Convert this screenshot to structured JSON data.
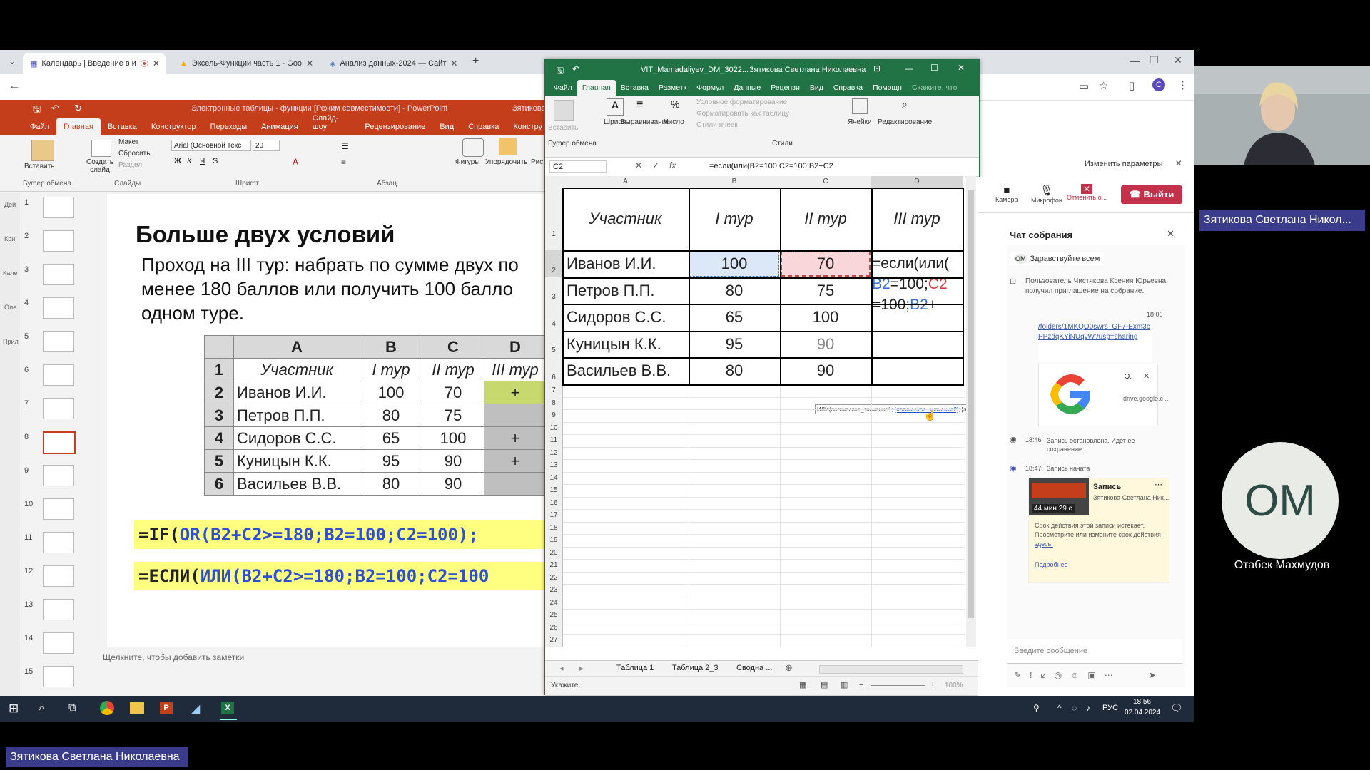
{
  "browser": {
    "tabs": [
      {
        "label": "Календарь | Введение в и",
        "active": true
      },
      {
        "label": "Эксель-Функции часть 1 - Goo",
        "active": false
      },
      {
        "label": "Анализ данных-2024 — Сайт",
        "active": false
      }
    ]
  },
  "ppt": {
    "title": "Электронные таблицы - функции [Режим совместимости] - PowerPoint",
    "user": "Зятикова",
    "tabs": [
      "Файл",
      "Главная",
      "Вставка",
      "Конструктор",
      "Переходы",
      "Анимация",
      "Слайд-шоу",
      "Рецензирование",
      "Вид",
      "Справка",
      "Констру"
    ],
    "ribbon": {
      "paste": "Вставить",
      "new_slide": "Создать слайд",
      "layout": "Макет",
      "reset": "Сбросить",
      "section": "Раздел",
      "font_name": "Arial (Основной текс",
      "font_size": "20",
      "shapes": "Фигуры",
      "arrange": "Упорядочить",
      "drawing_short": "Рис",
      "groups": [
        "Буфер обмена",
        "Слайды",
        "Шрифт",
        "Абзац"
      ]
    },
    "thumb_numbers": [
      "1",
      "2",
      "3",
      "4",
      "5",
      "6",
      "7",
      "8",
      "9",
      "10",
      "11",
      "12",
      "13",
      "14",
      "15"
    ],
    "left_rail": [
      "Дей",
      "Кри",
      "Кале",
      "Оле",
      "Прил"
    ],
    "notes_placeholder": "Щелкните, чтобы добавить заметки",
    "slide": {
      "title": "Больше двух условий",
      "body": "Проход на III тур: набрать по сумме двух по менее 180 баллов или получить 100 балло одном туре.",
      "table": {
        "cols": [
          "A",
          "B",
          "C",
          "D"
        ],
        "header": [
          "Участник",
          "I тур",
          "II тур",
          "III тур"
        ],
        "rows": [
          {
            "n": "2",
            "name": "Иванов И.И.",
            "b": "100",
            "c": "70",
            "d": "+"
          },
          {
            "n": "3",
            "name": "Петров П.П.",
            "b": "80",
            "c": "75",
            "d": ""
          },
          {
            "n": "4",
            "name": "Сидоров С.С.",
            "b": "65",
            "c": "100",
            "d": "+"
          },
          {
            "n": "5",
            "name": "Куницын К.К.",
            "b": "95",
            "c": "90",
            "d": "+"
          },
          {
            "n": "6",
            "name": "Васильев В.В.",
            "b": "80",
            "c": "90",
            "d": ""
          }
        ],
        "header_row_num": "1"
      },
      "formula_en_prefix": "=IF(",
      "formula_en_func": "OR",
      "formula_en_rest": "(B2+C2>=180;B2=100;C2=100);",
      "formula_ru_prefix": "=ЕСЛИ(",
      "formula_ru_func": "ИЛИ",
      "formula_ru_rest": "(B2+C2>=180;B2=100;C2=100"
    }
  },
  "excel": {
    "title": "VIT_Mamadaliyev_DM_3022...",
    "user": "Зятикова Светлана Николаевна",
    "tabs": [
      "Файл",
      "Главная",
      "Вставка",
      "Разметк",
      "Формул",
      "Данные",
      "Рецензи",
      "Вид",
      "Справка",
      "Помощн",
      "Скажите, что"
    ],
    "ribbon": {
      "paste": "Вставить",
      "font": "Шрифт",
      "align": "Выравнивание",
      "number": "Число",
      "cond_format": "Условное форматирование",
      "format_table": "Форматировать как таблицу",
      "cell_styles": "Стили ячеек",
      "styles_group": "Стили",
      "cells": "Ячейки",
      "editing": "Редактирование",
      "clipboard_group": "Буфер обмена"
    },
    "namebox": "C2",
    "formula": "=если(или(B2=100;C2=100;B2+C2",
    "col_headers": [
      "A",
      "B",
      "C",
      "D"
    ],
    "header_cells": [
      "Участник",
      "I тур",
      "II тур",
      "III тур"
    ],
    "rows": [
      {
        "name": "Иванов И.И.",
        "b": "100",
        "c": "70"
      },
      {
        "name": "Петров П.П.",
        "b": "80",
        "c": "75"
      },
      {
        "name": "Сидоров С.С.",
        "b": "65",
        "c": "100"
      },
      {
        "name": "Куницын К.К.",
        "b": "95",
        "c": "90"
      },
      {
        "name": "Васильев В.В.",
        "b": "80",
        "c": "90"
      }
    ],
    "edit_line1": "=если(или(",
    "edit_line2_a": "B2",
    "edit_line2_b": "=100;",
    "edit_line2_c": "C2",
    "edit_line3_a": "=100;",
    "edit_line3_b": "B2",
    "edit_line3_c": "+",
    "tooltip_a": "ИЛИ(логическое_значение1; ",
    "tooltip_b": "[логическое_значение2]",
    "tooltip_c": "; [логическое_значение3]; [логическое_значение4]; ...)",
    "row_numbers": [
      "1",
      "2",
      "3",
      "4",
      "5",
      "6",
      "7",
      "8",
      "9",
      "10",
      "11",
      "12",
      "13",
      "14",
      "15",
      "16",
      "17",
      "18",
      "19",
      "20",
      "21",
      "22",
      "23",
      "24",
      "25",
      "26",
      "27"
    ],
    "sheet_tabs": [
      "Таблица 1",
      "Таблица 2_3",
      "Сводна ..."
    ],
    "status": "Укажите",
    "zoom": "100%"
  },
  "teams": {
    "change_params": "Изменить параметры",
    "camera": "Камера",
    "mic": "Микрофон",
    "cancel": "Отменить о...",
    "leave": "Выйти",
    "chat_title": "Чат собрания",
    "msg1_initials": "OM",
    "msg1": "Здравствуйте всем",
    "msg2": "Пользователь Чистякова Ксения Юрьевна получил приглашение на собрание.",
    "time1": "18:06",
    "link": "/folders/1MKQO0swrs_GF7-Exm3cPPzdqKYiNUqvW?usp=sharing",
    "drive_preview_letter": "Э.",
    "drive_label": "drive.google.c...",
    "rec_stop_time": "18:46",
    "rec_stop": "Запись остановлена. Идет ее сохранение...",
    "rec_start_time": "18:47",
    "rec_start": "Запись начата",
    "rec_card_title": "Запись",
    "rec_card_user": "Зятикова Светлана Ник...",
    "rec_duration": "44 мин 29 с",
    "rec_notice": "Срок действия этой записи истекает. Просмотрите или измените срок действия",
    "rec_here": "здесь.",
    "rec_more": "Подробнее",
    "input_placeholder": "Введите сообщение"
  },
  "taskbar": {
    "lang": "РУС",
    "time": "18:56",
    "date": "02.04.2024"
  },
  "participants": {
    "presenter_name_top": "Зятикова Светлана Никол...",
    "avatar_initials": "OM",
    "avatar_name": "Отабек Махмудов",
    "presenter_name_bottom": "Зятикова Светлана Николаевна"
  },
  "colors": {
    "ppt_accent": "#c43e1c",
    "excel_accent": "#217346",
    "teams_purple": "#3b3b8c",
    "leave_red": "#c4314b",
    "formula_highlight": "#ffff80",
    "b_ref": "#3b6fd1",
    "c_ref": "#d13b3b"
  }
}
